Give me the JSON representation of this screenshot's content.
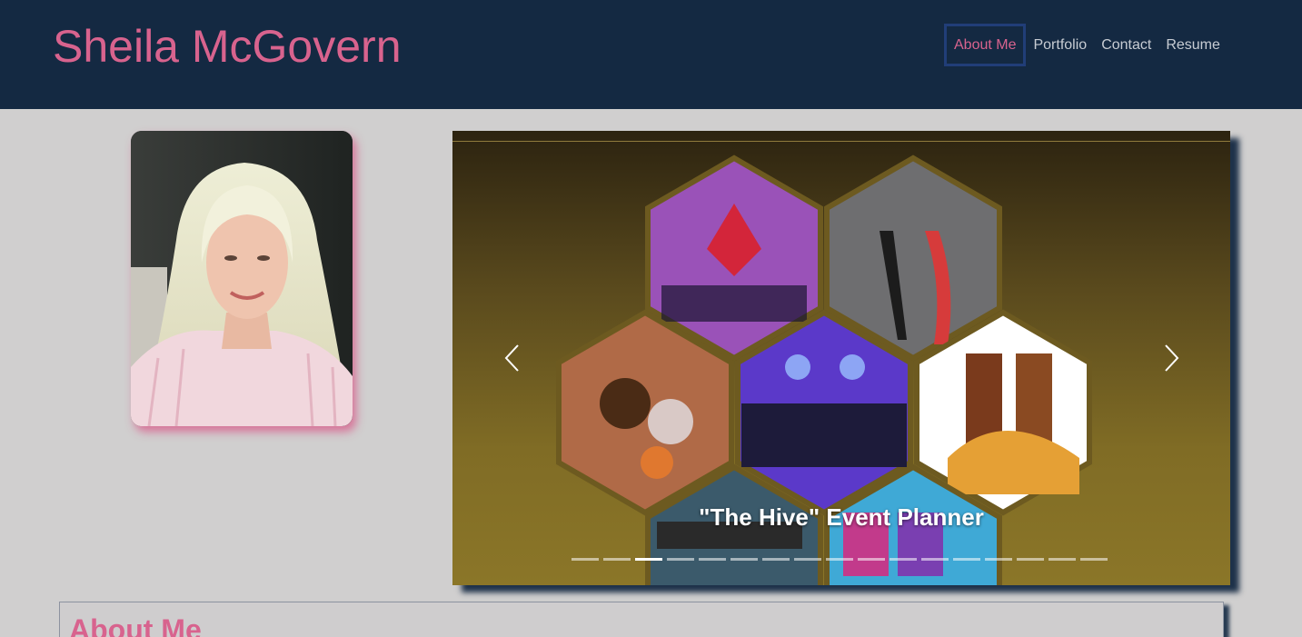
{
  "header": {
    "brand": "Sheila McGovern",
    "nav": [
      {
        "label": "About Me",
        "active": true
      },
      {
        "label": "Portfolio",
        "active": false
      },
      {
        "label": "Contact",
        "active": false
      },
      {
        "label": "Resume",
        "active": false
      }
    ]
  },
  "profile": {
    "photo_icon": "portrait-photo"
  },
  "carousel": {
    "caption": "\"The Hive\" Event Planner",
    "prev_icon": "chevron-left-icon",
    "next_icon": "chevron-right-icon",
    "slide_count": 17,
    "active_slide": 2
  },
  "about": {
    "title": "About Me"
  },
  "colors": {
    "header_bg": "#142942",
    "accent_pink": "#d8638e",
    "page_bg": "#d0cfcf",
    "nav_text": "#c7ccd3"
  }
}
